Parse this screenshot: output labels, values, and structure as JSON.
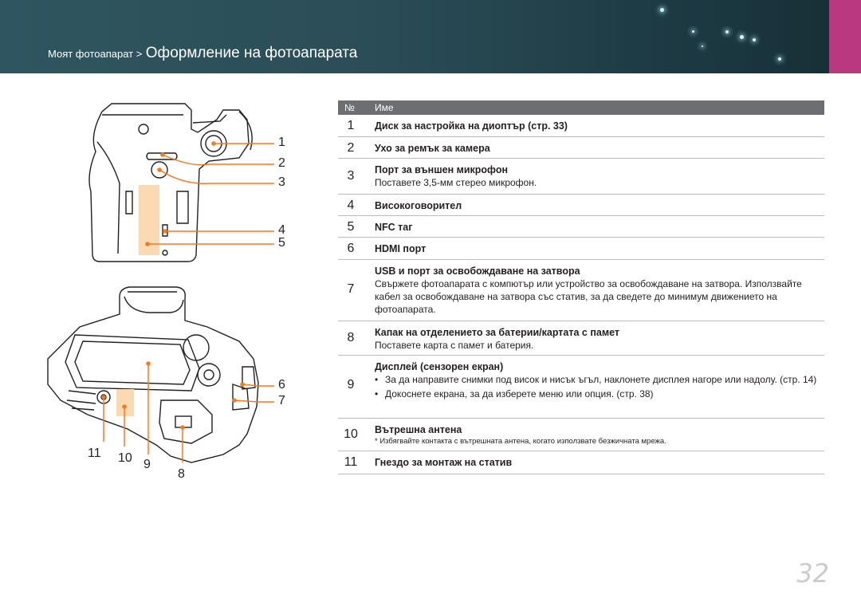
{
  "breadcrumb": {
    "parent": "Моят фотоапарат >",
    "current": "Оформление на фотоапарата"
  },
  "table": {
    "col_num": "№",
    "col_name": "Име",
    "rows": [
      {
        "num": "1",
        "title": "Диск за настройка на диоптър (стр. 33)"
      },
      {
        "num": "2",
        "title": "Ухо за ремък за камера"
      },
      {
        "num": "3",
        "title": "Порт за външен микрофон",
        "desc": "Поставете 3,5-мм стерео микрофон."
      },
      {
        "num": "4",
        "title": "Високоговорител"
      },
      {
        "num": "5",
        "title": "NFC таг"
      },
      {
        "num": "6",
        "title": "HDMI порт"
      },
      {
        "num": "7",
        "title": "USB и порт за освобождаване на затвора",
        "desc": "Свържете фотоапарата с компютър или устройство за освобождаване на затвора. Използвайте кабел за освобождаване на затвора със статив, за да сведете до минимум движението на фотоапарата."
      },
      {
        "num": "8",
        "title": "Капак на отделението за батерии/картата с памет",
        "desc": "Поставете карта с памет и батерия."
      },
      {
        "num": "9",
        "title": "Дисплей (сензорен екран)",
        "bullets": [
          "За да направите снимки под висок и нисък ъгъл, наклонете дисплея нагоре или надолу. (стр. 14)",
          "Докоснете екрана, за да изберете меню или опция. (стр. 38)"
        ]
      },
      {
        "num": "10",
        "title": "Вътрешна антена",
        "note": "* Избягвайте контакта с вътрешната антена, когато използвате безжичната мрежа."
      },
      {
        "num": "11",
        "title": "Гнездо за монтаж на статив"
      }
    ]
  },
  "callouts": {
    "c1": "1",
    "c2": "2",
    "c3": "3",
    "c4": "4",
    "c5": "5",
    "c6": "6",
    "c7": "7",
    "c8": "8",
    "c9": "9",
    "c10": "10",
    "c11": "11"
  },
  "page_number": "32",
  "colors": {
    "header": "#2b4d57",
    "accent": "#b8397e",
    "callout_line": "#f47b20",
    "highlight": "#fbd9b2",
    "table_header": "#6d6e71"
  }
}
